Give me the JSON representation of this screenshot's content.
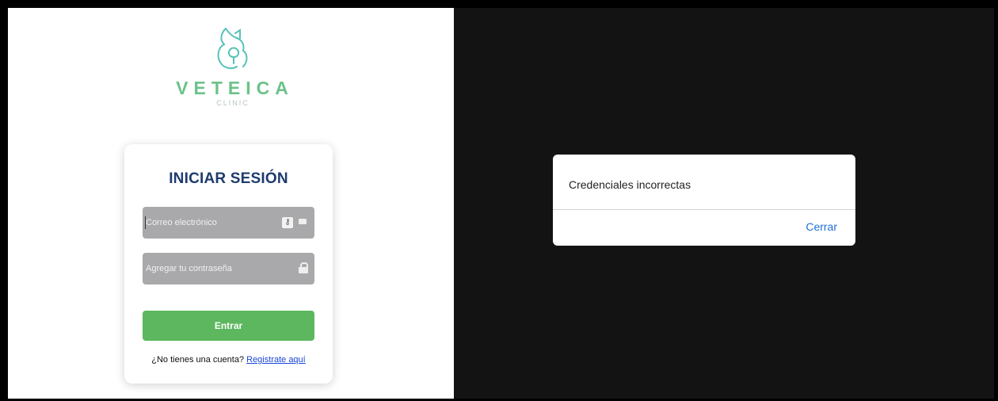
{
  "brand": {
    "name": "VETEICA",
    "subtitle": "CLINIC"
  },
  "login": {
    "title": "INICIAR SESIÓN",
    "email_placeholder": "Correo electrónico",
    "password_placeholder": "Agregar tu contraseña",
    "submit_label": "Entrar",
    "signup_prompt": "¿No tienes una cuenta?",
    "signup_link": "Registrate aquí"
  },
  "dialog": {
    "message": "Credenciales incorrectas",
    "close_label": "Cerrar"
  },
  "icons": {
    "logo": "cat-dog-logo-icon",
    "password_manager": "key-icon",
    "email": "envelope-icon",
    "password": "lock-icon"
  },
  "colors": {
    "brand_green": "#6cc28a",
    "title_navy": "#1d3b6e",
    "button_green": "#5cb75e",
    "link_blue": "#1a45d6",
    "dialog_action_blue": "#1f6fd4"
  }
}
